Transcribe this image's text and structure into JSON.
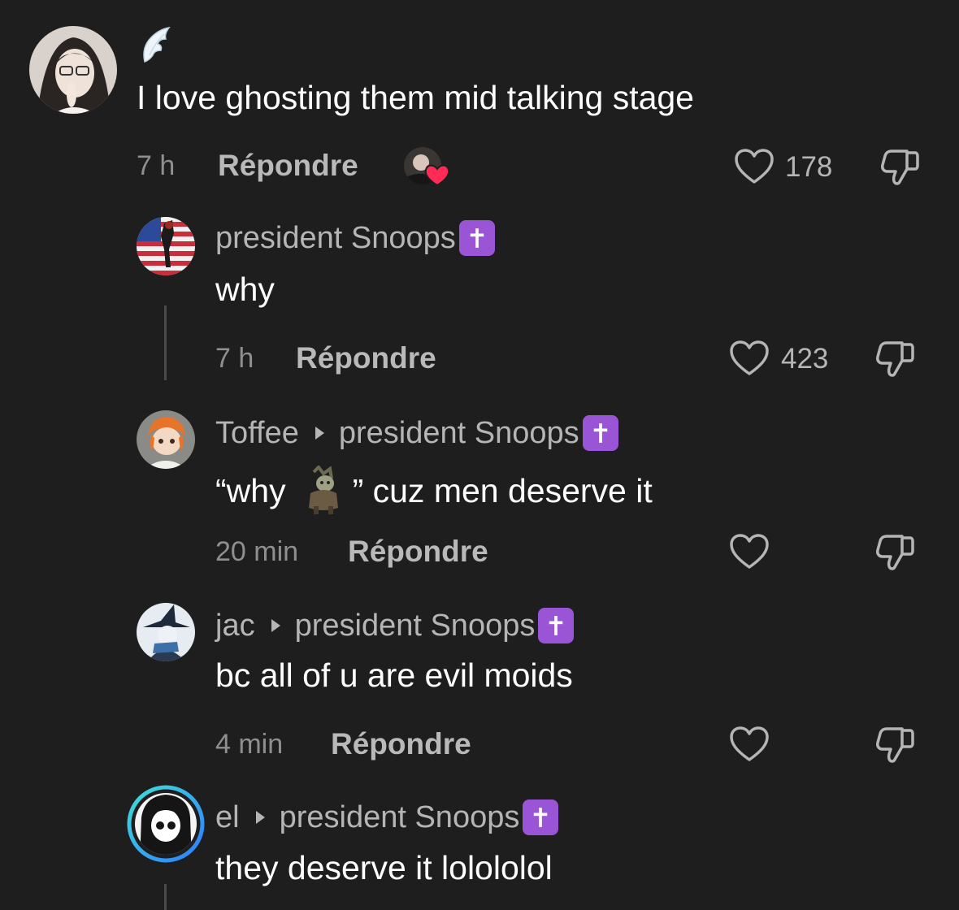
{
  "comments": [
    {
      "text": "I love ghosting them mid talking stage",
      "time": "7 h",
      "reply": "Répondre",
      "likes": "178"
    },
    {
      "author": "president Snoops",
      "text": "why",
      "time": "7 h",
      "reply": "Répondre",
      "likes": "423"
    },
    {
      "author": "Toffee",
      "reply_to": "president Snoops",
      "text_before": "“why",
      "text_after": "” cuz men deserve it",
      "time": "20 min",
      "reply": "Répondre"
    },
    {
      "author": "jac",
      "reply_to": "president Snoops",
      "text": "bc all of u are evil moids",
      "time": "4 min",
      "reply": "Répondre"
    },
    {
      "author": "el",
      "reply_to": "president Snoops",
      "text": "they deserve it lolololol"
    }
  ],
  "colors": {
    "background": "#1e1e1e",
    "badge": "#9a55d6",
    "heart_reaction": "#ff2b54",
    "story_ring_start": "#3ee0d6",
    "story_ring_end": "#2f7bff"
  },
  "icons": {
    "badge": "latin-cross-icon",
    "like": "heart-outline-icon",
    "dislike": "thumbs-down-icon",
    "flair": "angel-wing-icon"
  }
}
